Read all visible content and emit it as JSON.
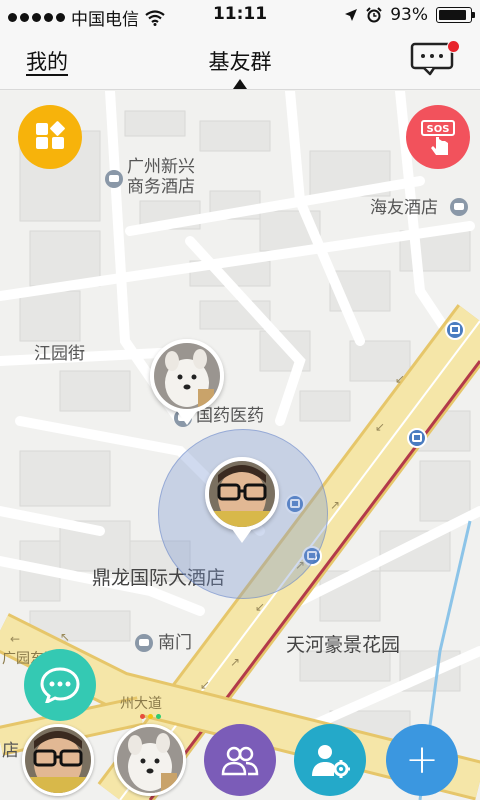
{
  "status_bar": {
    "carrier": "中国电信",
    "time": "11:11",
    "battery": "93%",
    "battery_level": 0.93,
    "icons": [
      "signal-dots-icon",
      "wifi-icon",
      "location-arrow-icon",
      "alarm-icon",
      "battery-icon"
    ]
  },
  "nav": {
    "left_label": "我的",
    "title": "基友群",
    "right_icon": "message-icon",
    "badge_color": "#e8242c"
  },
  "map": {
    "labels": {
      "hotel1": "广州新兴\n商务酒店",
      "hotel2": "海友酒店",
      "street1": "江园街",
      "pharmacy": "国药医药",
      "hotel3": "鼎龙国际大酒店",
      "gate": "南门",
      "garden": "天河豪景花园",
      "road1": "广园东路",
      "road2": "州大道",
      "road3": "园",
      "partial_left": "店"
    },
    "colors": {
      "road_major": "#f5e6a8",
      "road_edge": "#e6c66a",
      "rail": "#b33a4a",
      "accuracy": "#7896d2"
    }
  },
  "buttons": {
    "apps": {
      "icon": "apps-grid-icon",
      "color": "#f7b30b"
    },
    "sos": {
      "icon": "sos-icon",
      "label": "SOS",
      "color": "#f2525c"
    },
    "chat": {
      "icon": "chat-bubble-icon",
      "color": "#34c9b3"
    },
    "group": {
      "icon": "group-icon",
      "color": "#7b5cb8"
    },
    "user_settings": {
      "icon": "user-settings-icon",
      "color": "#24a9c9"
    },
    "add": {
      "icon": "plus-icon",
      "label": "+",
      "color": "#3b97e0"
    }
  }
}
